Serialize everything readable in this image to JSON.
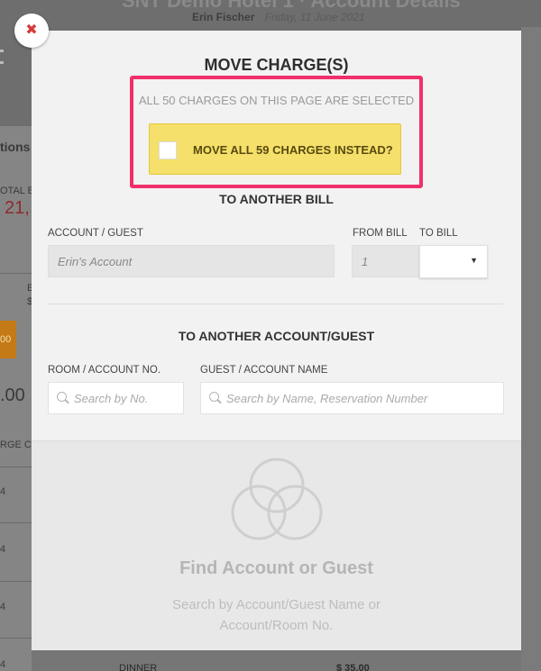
{
  "background": {
    "hotel_title": "SNT Demo Hotel 1 · Account Details",
    "guest_name": "Erin Fischer",
    "date": "Friday, 11 June 2021",
    "left_fragments": [
      "tions",
      "OTAL BA",
      "21,",
      "E",
      "$",
      "00",
      ".00",
      "RGE CO",
      "4",
      "4",
      "4",
      "4"
    ],
    "bottom_row": {
      "description": "DINNER",
      "amount": "$ 35.00"
    }
  },
  "modal": {
    "close_icon": "close-icon",
    "title": "MOVE CHARGE(S)",
    "selected_note": "ALL 50 CHARGES ON THIS PAGE ARE SELECTED",
    "move_all_label": "MOVE ALL 59 CHARGES INSTEAD?",
    "move_all_checked": false,
    "to_another_bill": {
      "heading": "TO ANOTHER BILL",
      "account_label": "ACCOUNT / GUEST",
      "account_value": "Erin's Account",
      "from_bill_label": "FROM BILL",
      "from_bill_value": "1",
      "to_bill_label": "TO BILL",
      "to_bill_value": ""
    },
    "to_another_account": {
      "heading": "TO ANOTHER ACCOUNT/GUEST",
      "room_label": "ROOM / ACCOUNT NO.",
      "room_placeholder": "Search by No.",
      "name_label": "GUEST / ACCOUNT NAME",
      "name_placeholder": "Search by Name, Reservation Number"
    },
    "results": {
      "icon": "venn-circles-icon",
      "title": "Find Account or Guest",
      "subtitle_line1": "Search by Account/Guest Name or",
      "subtitle_line2": "Account/Room No."
    }
  },
  "colors": {
    "highlight_border": "#f0306a",
    "move_all_bg": "#f4e06a",
    "close_x": "#d73a3a"
  }
}
